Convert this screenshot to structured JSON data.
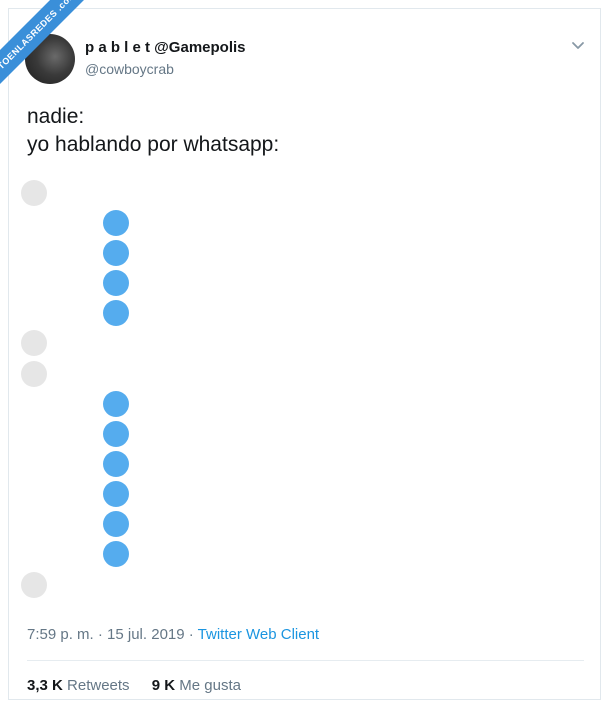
{
  "watermark": {
    "text": "VISTOENLASREDES .com"
  },
  "tweet": {
    "display_name": "p a b l e t @Gamepolis",
    "handle": "@cowboycrab",
    "text_line1": "nadie:",
    "text_line2": "yo hablando por whatsapp:",
    "time": "7:59 p. m. · 15 jul. 2019 ·",
    "client": "Twitter Web Client",
    "retweets_count": "3,3 K",
    "retweets_label": "Retweets",
    "likes_count": "9 K",
    "likes_label": "Me gusta"
  },
  "colors": {
    "accent": "#1b95e0",
    "bubble_self": "#55acee",
    "bubble_other": "#e6e6e6",
    "text_primary": "#14171a",
    "text_secondary": "#657786"
  },
  "icons": {
    "options": "chevron-down-icon"
  }
}
